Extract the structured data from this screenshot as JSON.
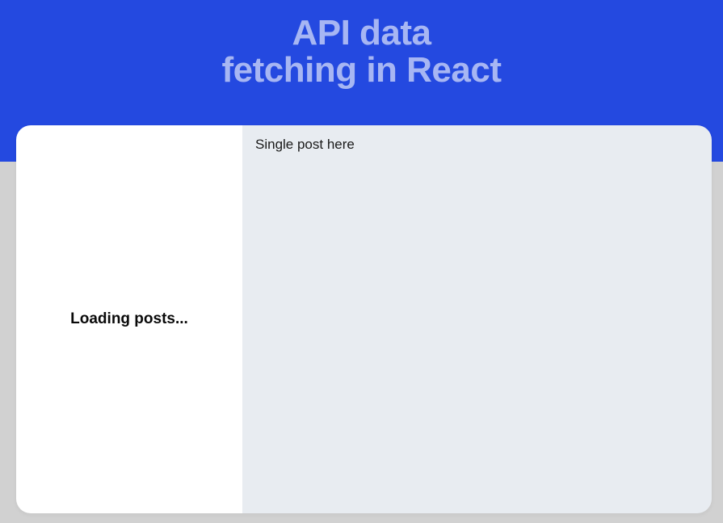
{
  "header": {
    "title_line1": "API data",
    "title_line2": "fetching in React"
  },
  "sidebar": {
    "loading_text": "Loading posts..."
  },
  "content": {
    "placeholder_text": "Single post here"
  }
}
